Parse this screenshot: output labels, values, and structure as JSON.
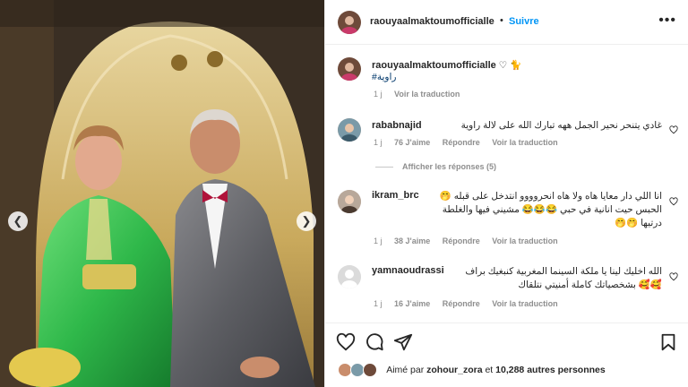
{
  "post": {
    "username": "raouyaalmaktoumofficialle",
    "follow_label": "Suivre",
    "more_icon": "more-horizontal-icon"
  },
  "caption": {
    "username": "raouyaalmaktoumofficialle",
    "emojis": "♡ 🐈",
    "hashtag": "#راوية",
    "time": "1 j",
    "translate": "Voir la traduction"
  },
  "comments": [
    {
      "username": "rababnajid",
      "text": "غادي يتنحر نحير الجمل ههه تبارك الله على لالة راوية",
      "time": "1 j",
      "likes": "76 J'aime",
      "reply": "Répondre",
      "translate": "Voir la traduction",
      "view_replies": "Afficher les réponses (5)"
    },
    {
      "username": "ikram_brc",
      "text": "انا اللي دار معايا هاه ولا هاه انحروووو انتدخل على قبله 🤭 الحبس حيت انانية في حبي 😂😂😂 مشيني فيها والغلطة درتيها 🤭🤭",
      "time": "1 j",
      "likes": "38 J'aime",
      "reply": "Répondre",
      "translate": "Voir la traduction"
    },
    {
      "username": "yamnaoudrassi",
      "text": "الله اخليك لينا يا ملكة السينما المغربية كنبغيك براف 🥰🥰 بشخصياتك كاملة أمنيتي نتلقاك",
      "time": "1 j",
      "likes": "16 J'aime",
      "reply": "Répondre",
      "translate": "Voir la traduction"
    }
  ],
  "likes_line": {
    "prefix": "Aimé par",
    "user": "zohour_zora",
    "middle": "et",
    "count": "10,288 autres personnes"
  },
  "colors": {
    "accent": "#0095f6",
    "text": "#262626",
    "muted": "#8e8e8e",
    "dress": "#2fb84a"
  }
}
